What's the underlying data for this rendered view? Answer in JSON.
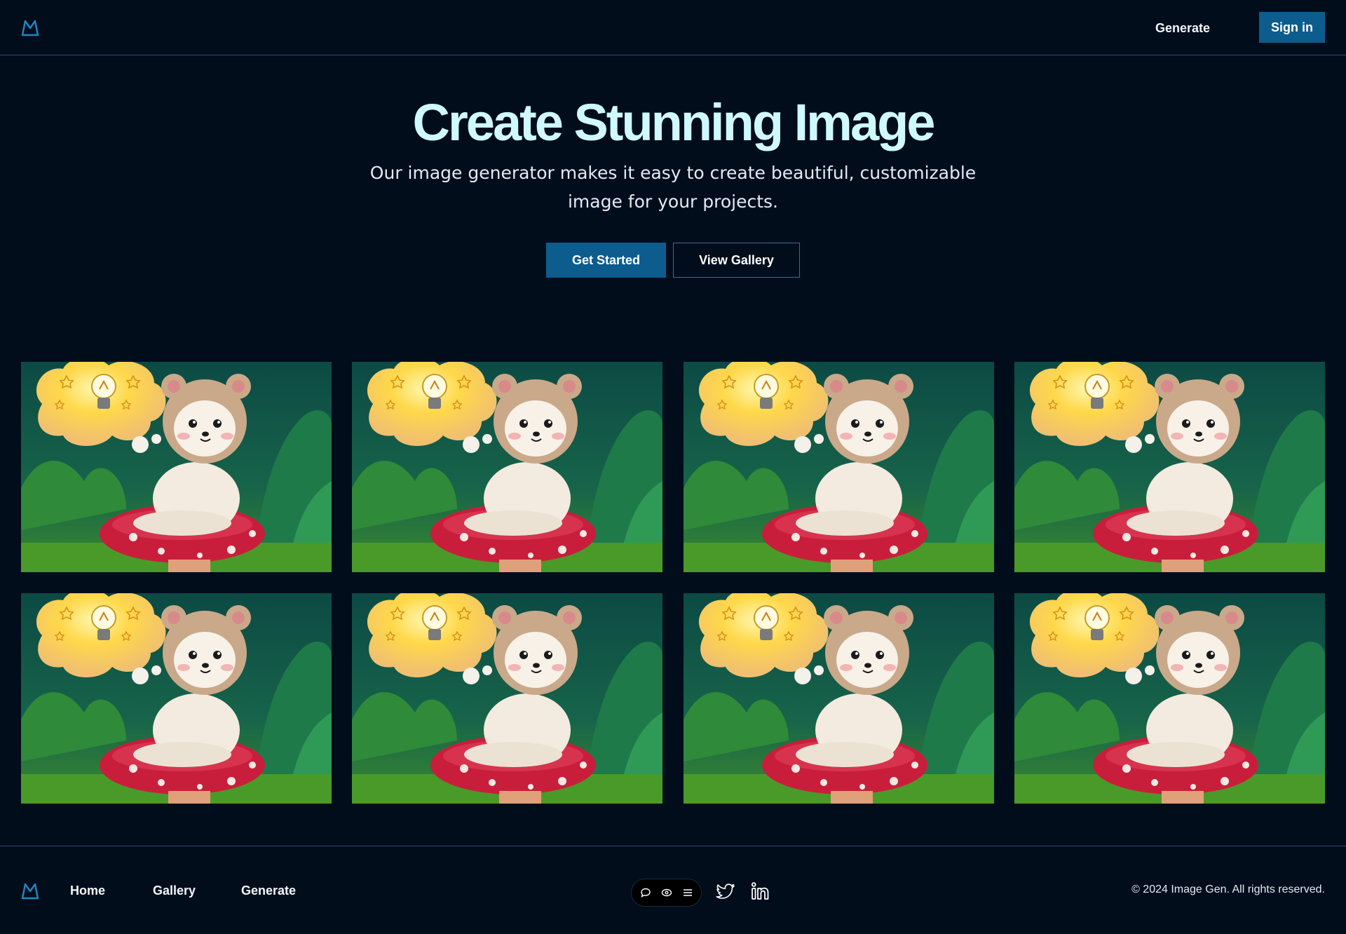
{
  "header": {
    "logo_icon": "mountain-logo-icon",
    "nav_generate": "Generate",
    "signin_label": "Sign in"
  },
  "hero": {
    "title": "Create Stunning Image",
    "subtitle": "Our image generator makes it easy to create beautiful, customizable image for your projects.",
    "primary_cta": "Get Started",
    "secondary_cta": "View Gallery"
  },
  "gallery": {
    "tiles": [
      {
        "image": "bear-mushroom-lightbulb"
      },
      {
        "image": "bear-mushroom-lightbulb"
      },
      {
        "image": "bear-mushroom-lightbulb"
      },
      {
        "image": "bear-mushroom-lightbulb"
      },
      {
        "image": "bear-mushroom-lightbulb"
      },
      {
        "image": "bear-mushroom-lightbulb"
      },
      {
        "image": "bear-mushroom-lightbulb"
      },
      {
        "image": "bear-mushroom-lightbulb"
      }
    ]
  },
  "footer": {
    "links": [
      "Home",
      "Gallery",
      "Generate"
    ],
    "social_icons": [
      "twitter-icon",
      "linkedin-icon"
    ],
    "widget_icons": [
      "chat-icon",
      "eye-icon",
      "menu-icon"
    ],
    "copyright": "© 2024 Image Gen. All rights reserved."
  },
  "colors": {
    "background": "#020d1c",
    "accent": "#0d5c8e",
    "title": "#cff9ff",
    "border": "#2a4a6e"
  }
}
